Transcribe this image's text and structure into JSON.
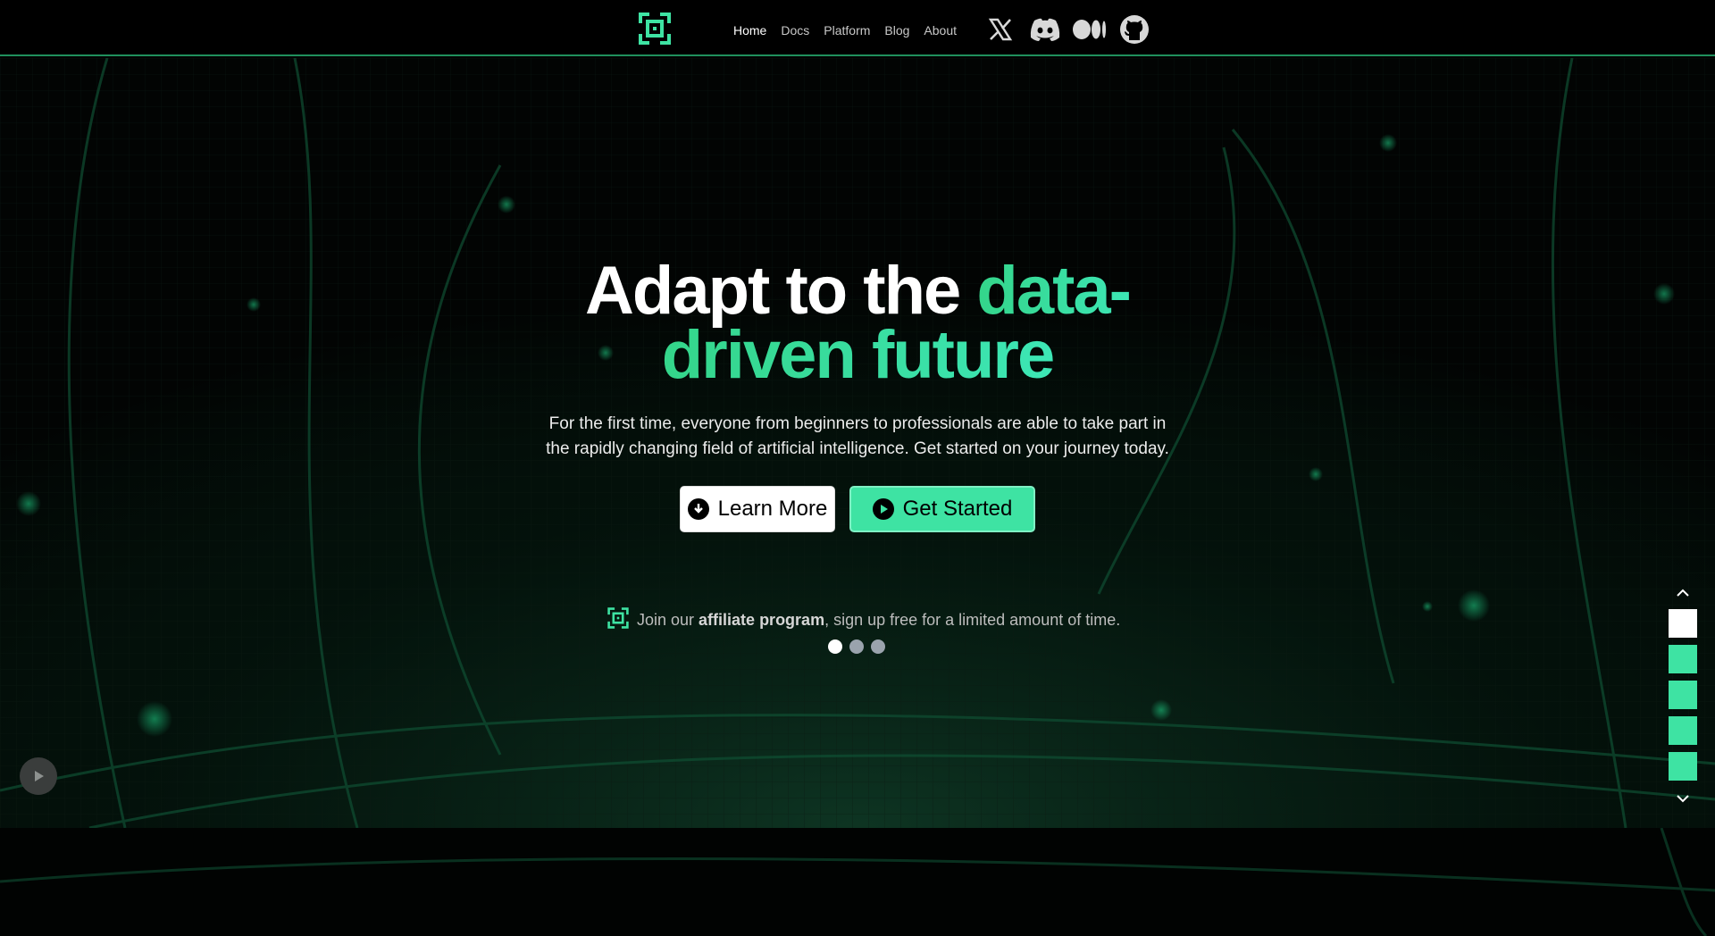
{
  "brand": {
    "accent": "#3ee3a3",
    "logo_icon": "square-in-frame-logo-icon"
  },
  "nav": {
    "links": [
      {
        "label": "Home",
        "active": true
      },
      {
        "label": "Docs",
        "active": false
      },
      {
        "label": "Platform",
        "active": false
      },
      {
        "label": "Blog",
        "active": false
      },
      {
        "label": "About",
        "active": false
      }
    ],
    "socials": [
      "x-icon",
      "discord-icon",
      "medium-icon",
      "github-icon"
    ]
  },
  "hero": {
    "title_plain": "Adapt to the ",
    "title_accent_1": "data-",
    "title_accent_2": "driven future",
    "subtitle_line1": "For the first time, everyone from beginners to professionals are able to take part in",
    "subtitle_line2": "the rapidly changing field of artificial intelligence. Get started on your journey today.",
    "learn_more": "Learn More",
    "get_started": "Get Started"
  },
  "affiliate": {
    "prefix": "Join our ",
    "link": "affiliate program",
    "suffix": ", sign up free for a limited amount of time."
  },
  "carousel": {
    "slides": 3,
    "active": 0
  },
  "pager": {
    "sections": 5,
    "active": 0
  }
}
